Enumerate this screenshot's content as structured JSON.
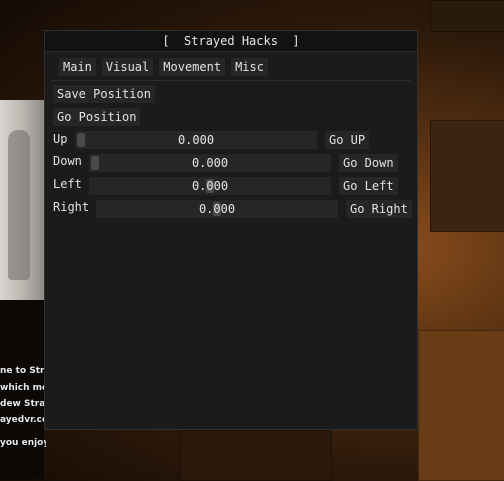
{
  "window": {
    "title": "[  Strayed Hacks  ]"
  },
  "tabs": [
    "Main",
    "Visual",
    "Movement",
    "Misc"
  ],
  "buttons": {
    "save_position": "Save Position",
    "go_position": "Go Position"
  },
  "rows": [
    {
      "label": "Up",
      "value": "0.000",
      "button": "Go UP"
    },
    {
      "label": "Down",
      "value": "0.000",
      "button": "Go Down"
    },
    {
      "label": "Left",
      "value": "0.000",
      "button": "Go Left"
    },
    {
      "label": "Right",
      "value": "0.000",
      "button": "Go Right"
    }
  ],
  "chat": [
    "ne to Stray",
    "which mea",
    "dew Straye",
    "ayedvr.com.",
    "you enjoy playing!"
  ],
  "colors": {
    "window_bg": "#1b1b1b",
    "title_bg": "#121212",
    "widget_bg": "#262626"
  }
}
